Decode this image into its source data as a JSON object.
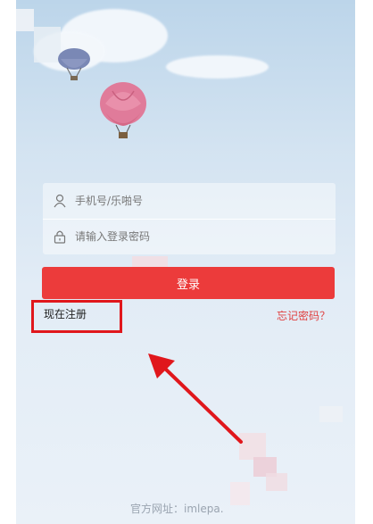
{
  "login": {
    "username_placeholder": "手机号/乐啪号",
    "password_placeholder": "请输入登录密码",
    "login_button": "登录",
    "register_link": "现在注册",
    "forgot_link": "忘记密码？"
  },
  "footer": {
    "text": "官方网址：imlepa."
  },
  "colors": {
    "accent": "#ec3b3b",
    "annotation": "#e0171c"
  }
}
